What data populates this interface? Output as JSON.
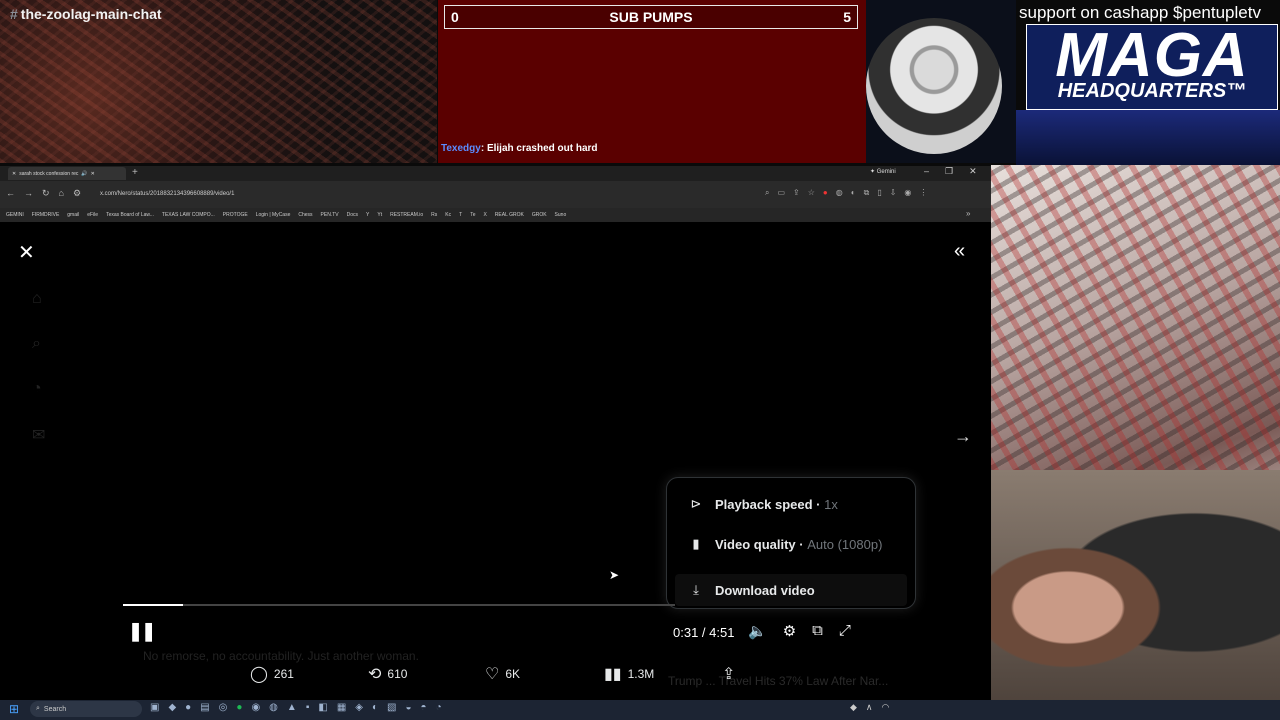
{
  "stream_overlay": {
    "chat_channel": "the-zoolag-main-chat",
    "poll": {
      "left_count": "0",
      "title": "SUB PUMPS",
      "right_count": "5"
    },
    "chat_message": {
      "user": "Texedgy",
      "text": "Elijah crashed out hard"
    },
    "support_text": "support on cashapp $pentupletv",
    "logo": {
      "title": "MAGA",
      "subtitle": "HEADQUARTERS™"
    }
  },
  "browser": {
    "tab_title": "sarah stock confession rec",
    "url": "x.com/Nero/status/2018832134396608889/video/1",
    "gemini_label": "Gemini",
    "bookmarks": [
      "GEMINI",
      "FIRMDRIVE",
      "gmail",
      "eFile",
      "Texas Board of Law...",
      "TEXAS LAW COMPO...",
      "PROTOGE",
      "Login | MyCase",
      "Chess",
      "PEN.TV",
      "Docs",
      "Y",
      "Yt",
      "RESTREAM.io",
      "Rs",
      "Kc",
      "T",
      "Te",
      "X",
      "REAL GROK",
      "GROK",
      "Suno"
    ]
  },
  "player": {
    "menu": {
      "playback_speed_label": "Playback speed",
      "playback_speed_value": "1x",
      "video_quality_label": "Video quality",
      "video_quality_value": "Auto (1080p)",
      "download_label": "Download video"
    },
    "time_display": "0:31 / 4:51",
    "progress_fraction": 0.109,
    "caption_ghost": "No remorse, no accountability. Just another woman.",
    "news_ghost": "Trump ... Travel Hits 37% Law After Nar..."
  },
  "actions": {
    "replies": "261",
    "reposts": "610",
    "likes": "6K",
    "views": "1.3M"
  },
  "taskbar": {
    "search_placeholder": "Search"
  }
}
